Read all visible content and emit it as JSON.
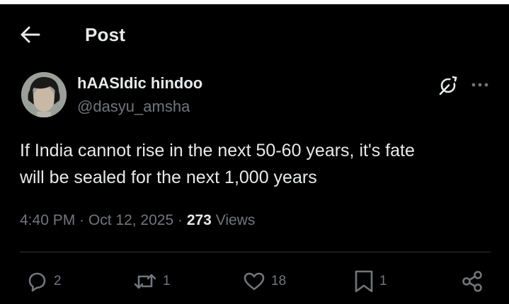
{
  "header": {
    "title": "Post"
  },
  "author": {
    "display_name": "hAASIdic hindoo",
    "handle": "@dasyu_amsha"
  },
  "tweet": {
    "text_line1": "If India cannot rise in the next 50-60 years, it's fate",
    "text_line2": "will be sealed for the next 1,000 years"
  },
  "meta": {
    "time": "4:40 PM",
    "separator1": " · ",
    "date": "Oct 12, 2025",
    "separator2": " · ",
    "views_count": "273",
    "views_label": " Views"
  },
  "actions": {
    "reply_count": "2",
    "repost_count": "1",
    "like_count": "18",
    "bookmark_count": "1"
  },
  "colors": {
    "background": "#000000",
    "text_primary": "#e7e9ea",
    "text_secondary": "#71767b",
    "divider": "#2f3336"
  },
  "icons": [
    "back-arrow-icon",
    "grok-icon",
    "more-icon",
    "reply-icon",
    "repost-icon",
    "like-icon",
    "bookmark-icon",
    "share-icon"
  ]
}
